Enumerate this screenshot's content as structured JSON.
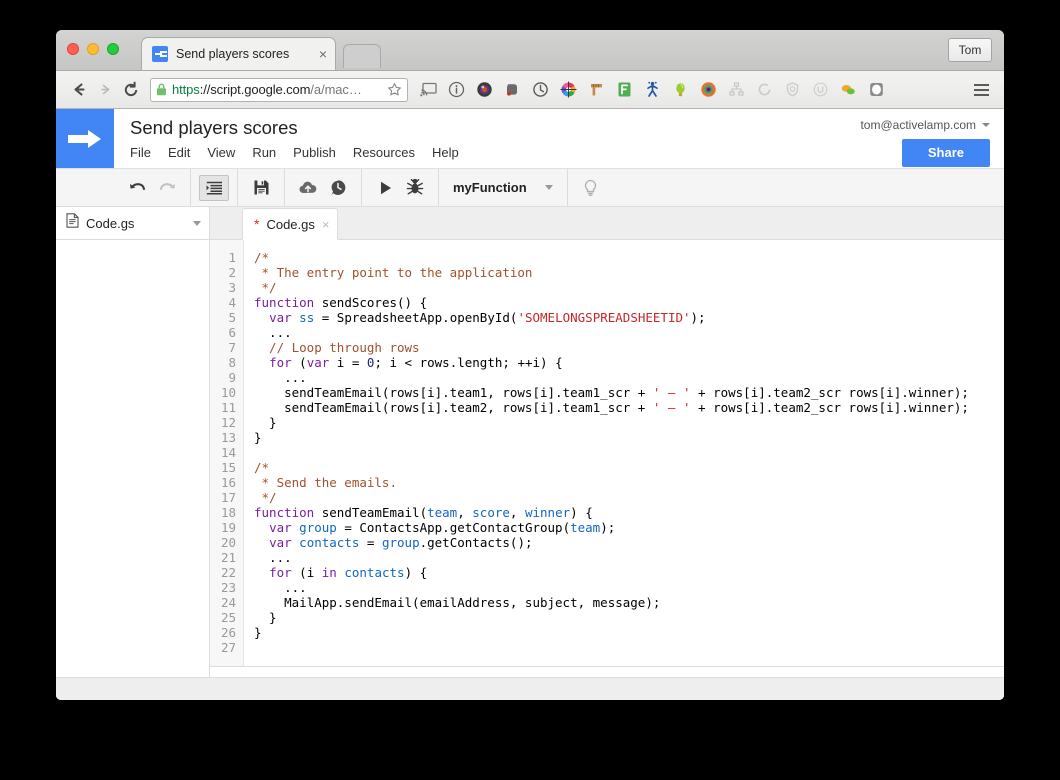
{
  "browser": {
    "tab": {
      "title": "Send players scores",
      "favicon": "apps-script-arrow-icon",
      "close": "×"
    },
    "newtab_label": "",
    "profile_button": "Tom",
    "nav": {
      "back": "back-arrow-icon",
      "forward": "forward-arrow-icon",
      "reload": "reload-icon"
    },
    "omnibox": {
      "lock": "lock-icon",
      "scheme": "https",
      "separator": "://",
      "host": "script.google.com",
      "path": "/a/mac",
      "ellipsis": "…",
      "full_url": "https://script.google.com/a/mac…",
      "star": "bookmark-star-icon"
    },
    "extensions": [
      "cast-icon",
      "info-circle-icon",
      "camera-lens-icon",
      "evernote-elephant-icon",
      "refresh-circle-icon",
      "color-wheel-icon",
      "ruler-icon",
      "f-square-icon",
      "person-icon",
      "lightbulb-drop-icon",
      "target-circle-icon",
      "sitemap-icon",
      "circle-arrow-icon",
      "bug-shield-icon",
      "u-circle-icon",
      "chat-bubbles-icon",
      "shield-white-icon"
    ],
    "menu_button": "hamburger-menu-icon"
  },
  "app": {
    "logo": "apps-script-arrow-icon",
    "doc_title": "Send players scores",
    "menus": [
      "File",
      "Edit",
      "View",
      "Run",
      "Publish",
      "Resources",
      "Help"
    ],
    "account_email": "tom@activelamp.com",
    "share_label": "Share",
    "accent_color": "#4285f4"
  },
  "toolbar": {
    "undo": "undo-icon",
    "redo": "redo-icon",
    "indent": "indent-format-icon",
    "save": "save-floppy-icon",
    "deploy": "cloud-upload-icon",
    "history": "version-history-clock-icon",
    "run": "run-play-icon",
    "debug": "debug-bug-icon",
    "function_name": "myFunction",
    "hint": "lightbulb-icon"
  },
  "sidebar": {
    "files": [
      {
        "name": "Code.gs",
        "icon": "file-document-icon"
      }
    ]
  },
  "editor": {
    "tab": {
      "dirty_marker": "*",
      "name": "Code.gs",
      "close": "×"
    },
    "line_numbers": [
      1,
      2,
      3,
      4,
      5,
      6,
      7,
      8,
      9,
      10,
      11,
      12,
      13,
      14,
      15,
      16,
      17,
      18,
      19,
      20,
      21,
      22,
      23,
      24,
      25,
      26,
      27
    ],
    "lines": [
      [
        {
          "t": "/*",
          "c": "cm"
        }
      ],
      [
        {
          "t": " * The entry point to the application",
          "c": "cm"
        }
      ],
      [
        {
          "t": " */",
          "c": "cm"
        }
      ],
      [
        {
          "t": "function",
          "c": "kw"
        },
        {
          "t": " sendScores() {",
          "c": "pl"
        }
      ],
      [
        {
          "t": "  ",
          "c": "pl"
        },
        {
          "t": "var",
          "c": "kw"
        },
        {
          "t": " ",
          "c": "pl"
        },
        {
          "t": "ss",
          "c": "vr"
        },
        {
          "t": " = SpreadsheetApp.openById(",
          "c": "pl"
        },
        {
          "t": "'SOMELONGSPREADSHEETID'",
          "c": "st"
        },
        {
          "t": ");",
          "c": "pl"
        }
      ],
      [
        {
          "t": "  ...",
          "c": "pl"
        }
      ],
      [
        {
          "t": "  // Loop through rows",
          "c": "cm"
        }
      ],
      [
        {
          "t": "  ",
          "c": "pl"
        },
        {
          "t": "for",
          "c": "kw"
        },
        {
          "t": " (",
          "c": "pl"
        },
        {
          "t": "var",
          "c": "kw"
        },
        {
          "t": " i = ",
          "c": "pl"
        },
        {
          "t": "0",
          "c": "nm"
        },
        {
          "t": "; i < rows.length; ++i) {",
          "c": "pl"
        }
      ],
      [
        {
          "t": "    ...",
          "c": "pl"
        }
      ],
      [
        {
          "t": "    sendTeamEmail(rows[i].team1, rows[i].team1_scr + ",
          "c": "pl"
        },
        {
          "t": "' – '",
          "c": "st"
        },
        {
          "t": " + rows[i].team2_scr rows[i].winner);",
          "c": "pl"
        }
      ],
      [
        {
          "t": "    sendTeamEmail(rows[i].team2, rows[i].team1_scr + ",
          "c": "pl"
        },
        {
          "t": "' – '",
          "c": "st"
        },
        {
          "t": " + rows[i].team2_scr rows[i].winner);",
          "c": "pl"
        }
      ],
      [
        {
          "t": "  }",
          "c": "pl"
        }
      ],
      [
        {
          "t": "}",
          "c": "pl"
        }
      ],
      [
        {
          "t": "",
          "c": "pl"
        }
      ],
      [
        {
          "t": "/*",
          "c": "cm"
        }
      ],
      [
        {
          "t": " * Send the emails.",
          "c": "cm"
        }
      ],
      [
        {
          "t": " */",
          "c": "cm"
        }
      ],
      [
        {
          "t": "function",
          "c": "kw"
        },
        {
          "t": " sendTeamEmail(",
          "c": "pl"
        },
        {
          "t": "team",
          "c": "vr"
        },
        {
          "t": ", ",
          "c": "pl"
        },
        {
          "t": "score",
          "c": "vr"
        },
        {
          "t": ", ",
          "c": "pl"
        },
        {
          "t": "winner",
          "c": "vr"
        },
        {
          "t": ") {",
          "c": "pl"
        }
      ],
      [
        {
          "t": "  ",
          "c": "pl"
        },
        {
          "t": "var",
          "c": "kw"
        },
        {
          "t": " ",
          "c": "pl"
        },
        {
          "t": "group",
          "c": "vr"
        },
        {
          "t": " = ContactsApp.getContactGroup(",
          "c": "pl"
        },
        {
          "t": "team",
          "c": "vr"
        },
        {
          "t": ");",
          "c": "pl"
        }
      ],
      [
        {
          "t": "  ",
          "c": "pl"
        },
        {
          "t": "var",
          "c": "kw"
        },
        {
          "t": " ",
          "c": "pl"
        },
        {
          "t": "contacts",
          "c": "vr"
        },
        {
          "t": " = ",
          "c": "pl"
        },
        {
          "t": "group",
          "c": "vr"
        },
        {
          "t": ".getContacts();",
          "c": "pl"
        }
      ],
      [
        {
          "t": "  ...",
          "c": "pl"
        }
      ],
      [
        {
          "t": "  ",
          "c": "pl"
        },
        {
          "t": "for",
          "c": "kw"
        },
        {
          "t": " (i ",
          "c": "pl"
        },
        {
          "t": "in",
          "c": "kw"
        },
        {
          "t": " ",
          "c": "pl"
        },
        {
          "t": "contacts",
          "c": "vr"
        },
        {
          "t": ") {",
          "c": "pl"
        }
      ],
      [
        {
          "t": "    ...",
          "c": "pl"
        }
      ],
      [
        {
          "t": "    MailApp.sendEmail(emailAddress, subject, message);",
          "c": "pl"
        }
      ],
      [
        {
          "t": "  }",
          "c": "pl"
        }
      ],
      [
        {
          "t": "}",
          "c": "pl"
        }
      ],
      [
        {
          "t": "",
          "c": "pl"
        }
      ]
    ]
  }
}
